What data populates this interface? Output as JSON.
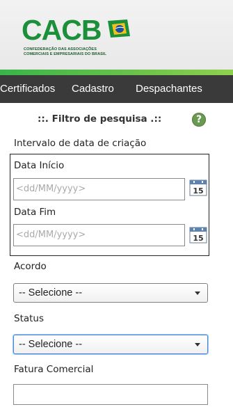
{
  "brand": {
    "logo_text": "CACB",
    "logo_sub_line1": "CONFEDERAÇÃO DAS ASSOCIAÇÕES",
    "logo_sub_line2": "COMERCIAIS E EMPRESARIAIS DO BRASIL",
    "accent": "#1b8f3a"
  },
  "nav": {
    "items": [
      {
        "label": "Certificados"
      },
      {
        "label": "Cadastro"
      },
      {
        "label": "Despachantes"
      }
    ]
  },
  "filter": {
    "title": "::. Filtro de pesquisa .::",
    "help_icon": "help-icon",
    "help_glyph": "?",
    "date_range_label": "Intervalo de data de criação",
    "start_label": "Data Início",
    "start_placeholder": "<dd/MM/yyyy>",
    "end_label": "Data Fim",
    "end_placeholder": "<dd/MM/yyyy>",
    "calendar_icon": "calendar-icon",
    "calendar_day": "15",
    "agreement_label": "Acordo",
    "agreement_value": "-- Selecione --",
    "status_label": "Status",
    "status_value": "-- Selecione --",
    "invoice_label": "Fatura Comercial",
    "invoice_value": ""
  }
}
